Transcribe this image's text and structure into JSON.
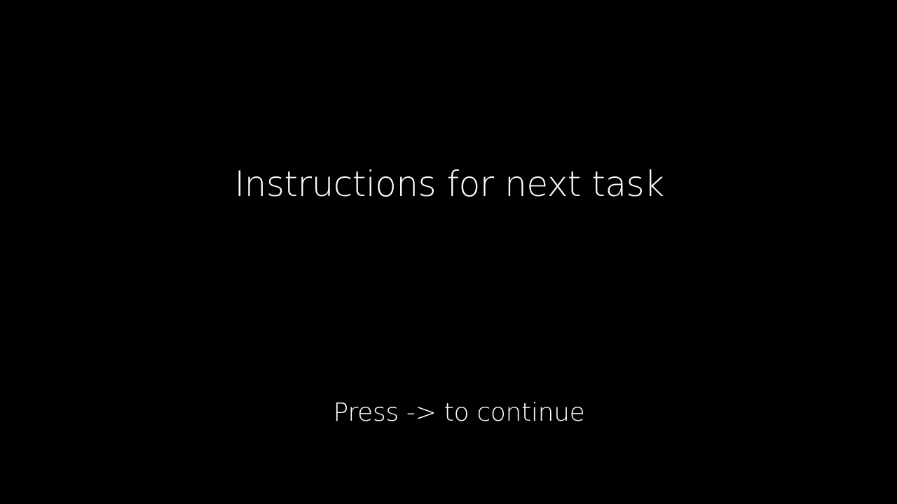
{
  "slide": {
    "title": "Instructions for next task",
    "continue_prompt": "Press -> to continue"
  },
  "colors": {
    "background": "#000000",
    "text": "#ffffff"
  }
}
